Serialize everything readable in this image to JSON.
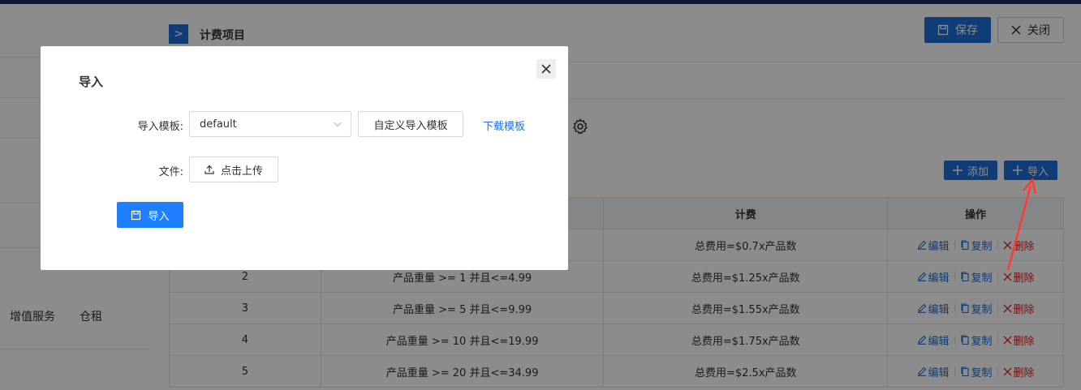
{
  "left_panel": {
    "tabs": [
      "增值服务",
      "仓租"
    ]
  },
  "drawer": {
    "title": "计费项目",
    "collapse_icon": ">",
    "save_label": "保存",
    "close_label": "关闭",
    "add_label": "添加",
    "import_label": "导入"
  },
  "table": {
    "headers": [
      "",
      "",
      "计费",
      "操作"
    ],
    "rows": [
      {
        "index": "",
        "condition": "",
        "fee": "总费用=$0.7x产品数"
      },
      {
        "index": "2",
        "condition": "产品重量 >= 1 并且<=4.99",
        "fee": "总费用=$1.25x产品数"
      },
      {
        "index": "3",
        "condition": "产品重量 >= 5 并且<=9.99",
        "fee": "总费用=$1.55x产品数"
      },
      {
        "index": "4",
        "condition": "产品重量 >= 10 并且<=19.99",
        "fee": "总费用=$1.75x产品数"
      },
      {
        "index": "5",
        "condition": "产品重量 >= 20 并且<=34.99",
        "fee": "总费用=$2.5x产品数"
      }
    ],
    "actions": {
      "edit": "编辑",
      "copy": "复制",
      "delete": "删除"
    }
  },
  "modal": {
    "title": "导入",
    "template_label": "导入模板:",
    "template_value": "default",
    "custom_template_label": "自定义导入模板",
    "download_template_label": "下载模板",
    "file_label": "文件:",
    "upload_label": "点击上传",
    "import_button_label": "导入"
  },
  "colors": {
    "primary": "#1e6fd9",
    "danger": "#e02020",
    "overlay": "rgba(0,0,0,0.45)"
  }
}
